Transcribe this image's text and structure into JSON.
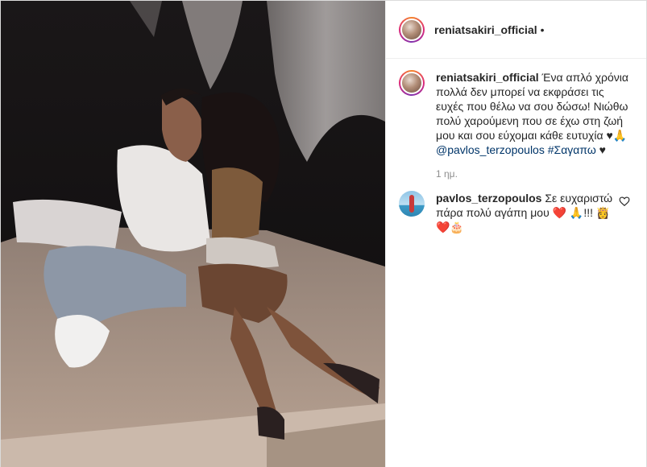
{
  "post": {
    "author": "reniatsakiri_official",
    "header_dot": "•",
    "caption": {
      "username": "reniatsakiri_official",
      "text": "Ένα απλό χρόνια πολλά δεν μπορεί να εκφράσει τις ευχές που θέλω να σου δώσω! Νιώθω πολύ χαρούμενη που σε έχω στη ζωή μου και σου εύχομαι κάθε ευτυχία ♥🙏",
      "mention": "@pavlos_terzopoulos",
      "hashtag": "#Σαγαπω",
      "tail": "♥"
    },
    "timestamp": "1 ημ.",
    "comments": [
      {
        "username": "pavlos_terzopoulos",
        "text": "Σε ευχαριστώ πάρα πολύ αγάπη μου ❤️ 🙏!!! 👸❤️🎂",
        "like_icon": "heart-outline-icon"
      }
    ]
  },
  "colors": {
    "text": "#262626",
    "muted": "#8e8e8e",
    "link": "#003569",
    "border": "#efefef"
  }
}
